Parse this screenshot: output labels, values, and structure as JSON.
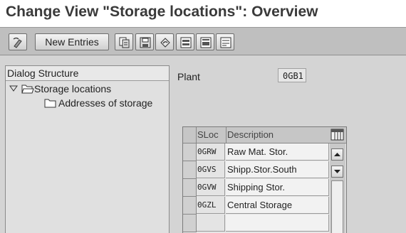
{
  "window": {
    "title": "Change View \"Storage locations\": Overview"
  },
  "toolbar": {
    "new_entries_label": "New Entries",
    "icons": [
      "display-change-icon",
      "copy-icon",
      "save-icon",
      "undo-icon",
      "select-all-icon",
      "select-block-icon",
      "deselect-all-icon"
    ]
  },
  "dialog_structure": {
    "header": "Dialog Structure",
    "items": [
      {
        "label": "Storage locations",
        "expanded": true
      },
      {
        "label": "Addresses of storage"
      }
    ]
  },
  "plant": {
    "label": "Plant",
    "value": "0GB1"
  },
  "table": {
    "columns": [
      "SLoc",
      "Description"
    ],
    "rows": [
      {
        "sloc": "0GRW",
        "description": "Raw Mat. Stor."
      },
      {
        "sloc": "0GVS",
        "description": "Shipp.Stor.South"
      },
      {
        "sloc": "0GVW",
        "description": "Shipping Stor."
      },
      {
        "sloc": "0GZL",
        "description": "Central Storage"
      },
      {
        "sloc": "",
        "description": ""
      }
    ]
  },
  "colors": {
    "title_bg": "#ffffff",
    "toolbar_bg": "#bfbfbf",
    "panel_bg": "#d4d4d4",
    "title_text": "#3a3a3a"
  }
}
